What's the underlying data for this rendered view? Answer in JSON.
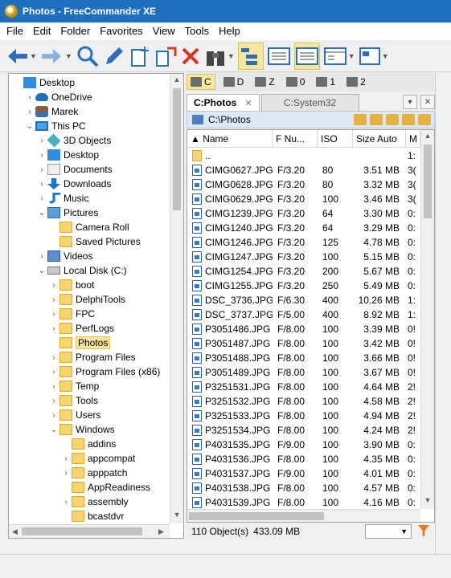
{
  "window": {
    "title": "Photos - FreeCommander XE"
  },
  "menu": [
    "File",
    "Edit",
    "Folder",
    "Favorites",
    "View",
    "Tools",
    "Help"
  ],
  "tree": [
    {
      "label": "Desktop",
      "indent": 0,
      "exp": "",
      "icon": "desk"
    },
    {
      "label": "OneDrive",
      "indent": 1,
      "exp": "›",
      "icon": "cloud"
    },
    {
      "label": "Marek",
      "indent": 1,
      "exp": "›",
      "icon": "user"
    },
    {
      "label": "This PC",
      "indent": 1,
      "exp": "⌄",
      "icon": "pc"
    },
    {
      "label": "3D Objects",
      "indent": 2,
      "exp": "›",
      "icon": "obj3d"
    },
    {
      "label": "Desktop",
      "indent": 2,
      "exp": "›",
      "icon": "desk"
    },
    {
      "label": "Documents",
      "indent": 2,
      "exp": "›",
      "icon": "doc"
    },
    {
      "label": "Downloads",
      "indent": 2,
      "exp": "›",
      "icon": "down"
    },
    {
      "label": "Music",
      "indent": 2,
      "exp": "›",
      "icon": "music"
    },
    {
      "label": "Pictures",
      "indent": 2,
      "exp": "⌄",
      "icon": "pics"
    },
    {
      "label": "Camera Roll",
      "indent": 3,
      "exp": "",
      "icon": "folder"
    },
    {
      "label": "Saved Pictures",
      "indent": 3,
      "exp": "",
      "icon": "folder"
    },
    {
      "label": "Videos",
      "indent": 2,
      "exp": "›",
      "icon": "video"
    },
    {
      "label": "Local Disk (C:)",
      "indent": 2,
      "exp": "⌄",
      "icon": "disk"
    },
    {
      "label": "boot",
      "indent": 3,
      "exp": "›",
      "icon": "folder"
    },
    {
      "label": "DelphiTools",
      "indent": 3,
      "exp": "›",
      "icon": "folder"
    },
    {
      "label": "FPC",
      "indent": 3,
      "exp": "›",
      "icon": "folder"
    },
    {
      "label": "PerfLogs",
      "indent": 3,
      "exp": "›",
      "icon": "folder"
    },
    {
      "label": "Photos",
      "indent": 3,
      "exp": "",
      "icon": "folder",
      "selected": true
    },
    {
      "label": "Program Files",
      "indent": 3,
      "exp": "›",
      "icon": "folder"
    },
    {
      "label": "Program Files (x86)",
      "indent": 3,
      "exp": "›",
      "icon": "folder"
    },
    {
      "label": "Temp",
      "indent": 3,
      "exp": "›",
      "icon": "folder"
    },
    {
      "label": "Tools",
      "indent": 3,
      "exp": "›",
      "icon": "folder"
    },
    {
      "label": "Users",
      "indent": 3,
      "exp": "›",
      "icon": "folder"
    },
    {
      "label": "Windows",
      "indent": 3,
      "exp": "⌄",
      "icon": "folder"
    },
    {
      "label": "addins",
      "indent": 4,
      "exp": "",
      "icon": "folder"
    },
    {
      "label": "appcompat",
      "indent": 4,
      "exp": "›",
      "icon": "folder"
    },
    {
      "label": "apppatch",
      "indent": 4,
      "exp": "›",
      "icon": "folder"
    },
    {
      "label": "AppReadiness",
      "indent": 4,
      "exp": "",
      "icon": "folder"
    },
    {
      "label": "assembly",
      "indent": 4,
      "exp": "›",
      "icon": "folder"
    },
    {
      "label": "bcastdvr",
      "indent": 4,
      "exp": "",
      "icon": "folder"
    }
  ],
  "drives": [
    {
      "label": "C",
      "active": true
    },
    {
      "label": "D",
      "active": false
    },
    {
      "label": "Z",
      "active": false
    },
    {
      "label": "0",
      "active": false
    },
    {
      "label": "1",
      "active": false
    },
    {
      "label": "2",
      "active": false
    }
  ],
  "tabs": {
    "active": "C:Photos",
    "inactive": "C:System32"
  },
  "path": "C:\\Photos",
  "columns": {
    "name": "Name",
    "fnum": "F Nu...",
    "iso": "ISO",
    "size": "Size Auto",
    "m": "M"
  },
  "files": [
    {
      "name": "..",
      "f": "",
      "iso": "",
      "size": "",
      "m": "1:",
      "folder": true
    },
    {
      "name": "CIMG0627.JPG",
      "f": "F/3.20",
      "iso": "80",
      "size": "3.51 MB",
      "m": "3("
    },
    {
      "name": "CIMG0628.JPG",
      "f": "F/3.20",
      "iso": "80",
      "size": "3.32 MB",
      "m": "3("
    },
    {
      "name": "CIMG0629.JPG",
      "f": "F/3.20",
      "iso": "100",
      "size": "3.46 MB",
      "m": "3("
    },
    {
      "name": "CIMG1239.JPG",
      "f": "F/3.20",
      "iso": "64",
      "size": "3.30 MB",
      "m": "0:"
    },
    {
      "name": "CIMG1240.JPG",
      "f": "F/3.20",
      "iso": "64",
      "size": "3.29 MB",
      "m": "0:"
    },
    {
      "name": "CIMG1246.JPG",
      "f": "F/3.20",
      "iso": "125",
      "size": "4.78 MB",
      "m": "0:"
    },
    {
      "name": "CIMG1247.JPG",
      "f": "F/3.20",
      "iso": "100",
      "size": "5.15 MB",
      "m": "0:"
    },
    {
      "name": "CIMG1254.JPG",
      "f": "F/3.20",
      "iso": "200",
      "size": "5.67 MB",
      "m": "0:"
    },
    {
      "name": "CIMG1255.JPG",
      "f": "F/3.20",
      "iso": "250",
      "size": "5.49 MB",
      "m": "0:"
    },
    {
      "name": "DSC_3736.JPG",
      "f": "F/6.30",
      "iso": "400",
      "size": "10.26 MB",
      "m": "1:"
    },
    {
      "name": "DSC_3737.JPG",
      "f": "F/5.00",
      "iso": "400",
      "size": "8.92 MB",
      "m": "1:"
    },
    {
      "name": "P3051486.JPG",
      "f": "F/8.00",
      "iso": "100",
      "size": "3.39 MB",
      "m": "0!"
    },
    {
      "name": "P3051487.JPG",
      "f": "F/8.00",
      "iso": "100",
      "size": "3.42 MB",
      "m": "0!"
    },
    {
      "name": "P3051488.JPG",
      "f": "F/8.00",
      "iso": "100",
      "size": "3.66 MB",
      "m": "0!"
    },
    {
      "name": "P3051489.JPG",
      "f": "F/8.00",
      "iso": "100",
      "size": "3.67 MB",
      "m": "0!"
    },
    {
      "name": "P3251531.JPG",
      "f": "F/8.00",
      "iso": "100",
      "size": "4.64 MB",
      "m": "2!"
    },
    {
      "name": "P3251532.JPG",
      "f": "F/8.00",
      "iso": "100",
      "size": "4.58 MB",
      "m": "2!"
    },
    {
      "name": "P3251533.JPG",
      "f": "F/8.00",
      "iso": "100",
      "size": "4.94 MB",
      "m": "2!"
    },
    {
      "name": "P3251534.JPG",
      "f": "F/8.00",
      "iso": "100",
      "size": "4.24 MB",
      "m": "2!"
    },
    {
      "name": "P4031535.JPG",
      "f": "F/9.00",
      "iso": "100",
      "size": "3.90 MB",
      "m": "0:"
    },
    {
      "name": "P4031536.JPG",
      "f": "F/8.00",
      "iso": "100",
      "size": "4.35 MB",
      "m": "0:"
    },
    {
      "name": "P4031537.JPG",
      "f": "F/9.00",
      "iso": "100",
      "size": "4.01 MB",
      "m": "0:"
    },
    {
      "name": "P4031538.JPG",
      "f": "F/8.00",
      "iso": "100",
      "size": "4.57 MB",
      "m": "0:"
    },
    {
      "name": "P4031539.JPG",
      "f": "F/8.00",
      "iso": "100",
      "size": "4.16 MB",
      "m": "0:"
    }
  ],
  "status": {
    "objects": "110 Object(s)",
    "size": "433.09 MB"
  },
  "colors": {
    "titlebar": "#1f6fbf",
    "selection": "#f5e59a",
    "folder": "#f7d56a"
  }
}
